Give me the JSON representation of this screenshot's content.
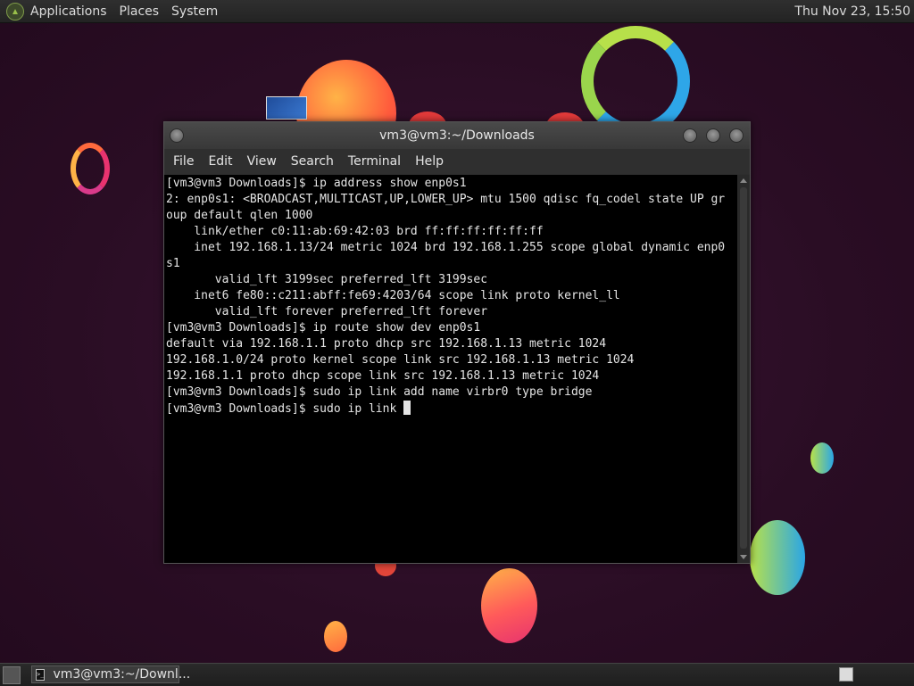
{
  "top_panel": {
    "menus": [
      "Applications",
      "Places",
      "System"
    ],
    "clock": "Thu Nov 23, 15:50"
  },
  "window": {
    "title": "vm3@vm3:~/Downloads",
    "menu": [
      "File",
      "Edit",
      "View",
      "Search",
      "Terminal",
      "Help"
    ]
  },
  "terminal": {
    "lines": [
      "[vm3@vm3 Downloads]$ ip address show enp0s1",
      "2: enp0s1: <BROADCAST,MULTICAST,UP,LOWER_UP> mtu 1500 qdisc fq_codel state UP gr",
      "oup default qlen 1000",
      "    link/ether c0:11:ab:69:42:03 brd ff:ff:ff:ff:ff:ff",
      "    inet 192.168.1.13/24 metric 1024 brd 192.168.1.255 scope global dynamic enp0",
      "s1",
      "       valid_lft 3199sec preferred_lft 3199sec",
      "    inet6 fe80::c211:abff:fe69:4203/64 scope link proto kernel_ll",
      "       valid_lft forever preferred_lft forever",
      "[vm3@vm3 Downloads]$ ip route show dev enp0s1",
      "default via 192.168.1.1 proto dhcp src 192.168.1.13 metric 1024",
      "192.168.1.0/24 proto kernel scope link src 192.168.1.13 metric 1024",
      "192.168.1.1 proto dhcp scope link src 192.168.1.13 metric 1024",
      "[vm3@vm3 Downloads]$ sudo ip link add name virbr0 type bridge"
    ],
    "current_input": "[vm3@vm3 Downloads]$ sudo ip link "
  },
  "taskbar": {
    "task_label": "vm3@vm3:~/Downl..."
  },
  "colors": {
    "background": "#2a0d24",
    "terminal_bg": "#000000",
    "terminal_fg": "#e5e5e5"
  },
  "icons": {
    "panel_logo": "gnome-foot-icon",
    "task": "terminal-icon",
    "show_desktop": "show-desktop-icon"
  }
}
